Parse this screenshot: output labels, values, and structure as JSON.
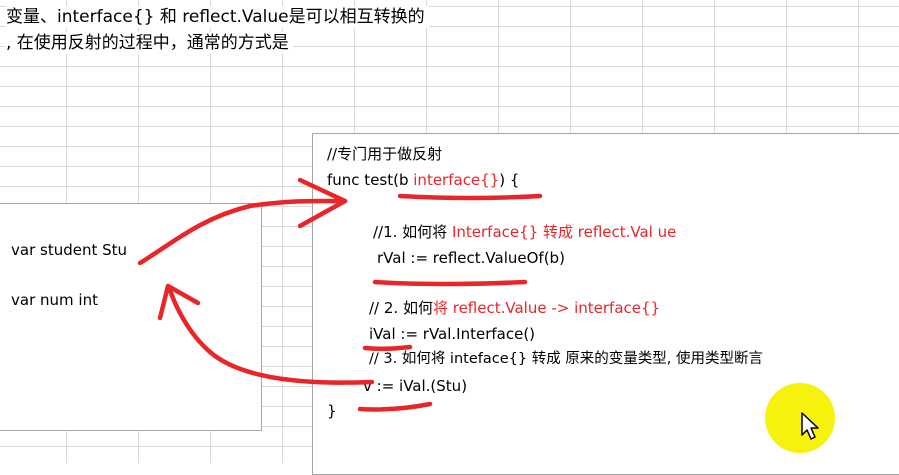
{
  "intro": {
    "line1": "变量、interface{} 和 reflect.Value是可以相互转换的",
    "line2": ", 在使用反射的过程中，通常的方式是"
  },
  "left_panel": {
    "var_student": "var student Stu",
    "var_num": "var num int"
  },
  "code": {
    "comment_main": "//专门用于做反射",
    "func_prefix": "func test(b ",
    "func_param_type": "interface{}",
    "func_suffix": ") {",
    "step1_prefix": "//1. 如何将 ",
    "step1_highlight": "Interface{} 转成 reflect.Val ue",
    "step1_code": "rVal := reflect.ValueOf(b)",
    "step2_prefix": "// 2. 如何",
    "step2_highlight": "将 reflect.Value -> interface{}",
    "step2_code": "iVal := rVal.Interface()",
    "step3_comment": "// 3. 如何将 inteface{} 转成 原来的变量类型, 使用类型断言",
    "step3_code": "v := iVal.(Stu)",
    "close_brace": "}"
  },
  "colors": {
    "annotation_red": "#e8262a",
    "highlight_yellow": "#f5f000"
  },
  "icons": [
    "mouse-cursor-icon"
  ]
}
